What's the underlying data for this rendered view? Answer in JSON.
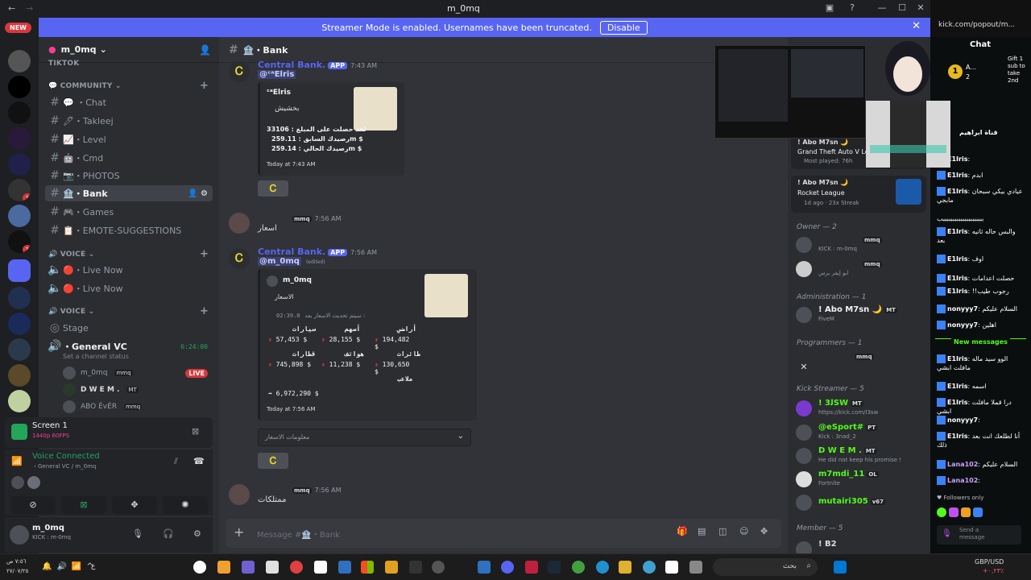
{
  "window": {
    "title": "m_0mq",
    "minimize": "—",
    "maximize": "☐",
    "close": "✕"
  },
  "banner": {
    "text": "Streamer Mode is enabled. Usernames have been truncated.",
    "disable": "Disable"
  },
  "rail": {
    "new_label": "NEW",
    "badges": [
      "1",
      "1"
    ]
  },
  "server": {
    "name": "m_0mq"
  },
  "channels": {
    "top_partial": "TIKTOK",
    "category_community": "COMMUNITY",
    "chat": "💬 ・Chat",
    "takleej": "🖊・Takleej",
    "level": "📈・Level",
    "cmd": "🤖・Cmd",
    "photos": "📷・PHOTOS",
    "bank": "🏦・Bank",
    "games": "🎮・Games",
    "emote": "📋・EMOTE-SUGGESTIONS",
    "category_voice1": "VOICE",
    "live_now_1": "🔴・Live Now",
    "live_now_2": "🔴・Live Now",
    "category_voice2": "VOICE",
    "stage": "Stage",
    "general_vc": "・General VC",
    "general_vc_time": "6:24:00",
    "status_hint": "Set a channel status",
    "voice_users": [
      {
        "name": "m_0mq",
        "tag": "mmq",
        "live": "LIVE"
      },
      {
        "name": "D W E M .",
        "tag": "MT"
      },
      {
        "name": "ABO ÉvÉR",
        "tag": "mmq"
      }
    ]
  },
  "screen_panel": {
    "title": "Screen 1",
    "sub": "1440p 60FPS"
  },
  "voice_panel": {
    "status": "Voice Connected",
    "location": "・General VC / m_0mq"
  },
  "user_panel": {
    "name": "m_0mq",
    "sub": "KICK : m-0mq"
  },
  "chat": {
    "header": "🏦・Bank",
    "messages": [
      {
        "author": "Central Bank.",
        "app": "APP",
        "time": "7:43 AM",
        "mention": "@ᶜᵃElris",
        "embed": {
          "author": "ᶜᵃElris",
          "title": "بخشيش",
          "line1": "لقد حصلت على المبلغ : 33106",
          "line2": "رصيدك السابق : 259.11m $",
          "line3": "رصيدك الحالي : 259.14m $",
          "footer": "Today at 7:43 AM"
        }
      },
      {
        "author": "mmq",
        "time": "7:56 AM",
        "text": "اسعار"
      },
      {
        "author": "Central Bank.",
        "app": "APP",
        "time": "7:56 AM",
        "mention": "@m_0mq",
        "edited": "(edited)",
        "embed": {
          "author": "m_0mq",
          "title": "الاسعار",
          "update_label": "سيتم تحديث الاسعار بعد :",
          "timer": "02:39.0",
          "items": [
            {
              "label": "سيارات",
              "value": "57,453 $"
            },
            {
              "label": "أسهم",
              "value": "28,155 $"
            },
            {
              "label": "أراضي",
              "value": "194,482 $"
            },
            {
              "label": "قطارات",
              "value": "745,898 $"
            },
            {
              "label": "هواتف",
              "value": "11,238 $"
            },
            {
              "label": "طائرات",
              "value": "130,650 $"
            },
            {
              "label": "ملاعب",
              "value": "6,972,290 $"
            }
          ],
          "footer": "Today at 7:56 AM"
        },
        "select": "معلومات الاسعار"
      },
      {
        "author": "mmq",
        "time": "7:56 AM",
        "text": "ممتلكات"
      }
    ],
    "input_placeholder": "Message #🏦・Bank"
  },
  "members": {
    "activity1": {
      "name": "! Abo M7sn 🌙",
      "game": "Grand Theft Auto V Legacy",
      "detail": "Most played: 76h"
    },
    "activity2": {
      "name": "! Abo M7sn 🌙",
      "game": "Rocket League",
      "detail": "1d ago",
      "streak": "23x Streak"
    },
    "owner_header": "Owner — 2",
    "owners": [
      {
        "name": "",
        "tag": "mmq",
        "sub": "KICK : m-0mq"
      },
      {
        "name": "",
        "tag": "mmq",
        "sub": "ابو إيفر برس"
      }
    ],
    "admin_header": "Administration — 1",
    "admins": [
      {
        "name": "! Abo M7sn 🌙",
        "tag": "MT",
        "sub": "FiveM"
      }
    ],
    "prog_header": "Programmers — 1",
    "programmers": [
      {
        "name": "",
        "tag": "mmq"
      }
    ],
    "kick_header": "Kick Streamer — 5",
    "kick_streamers": [
      {
        "name": "! ﻟ3SW",
        "tag": "MT",
        "sub": "https://kick.com/l3sw"
      },
      {
        "name": "@eSport#",
        "tag": "PT",
        "sub": "Kick : 3nad_2"
      },
      {
        "name": "D W E M .",
        "tag": "MT",
        "sub": "He did not keep his promise !"
      },
      {
        "name": "m7mdi_11",
        "tag": "OL",
        "sub": "Fortnite"
      },
      {
        "name": "mutairi305",
        "tag": "v67",
        "sub": ""
      }
    ],
    "member_header": "Member — 5",
    "member_first": "! B2"
  },
  "kick": {
    "url": "kick.com/popout/m...",
    "chat_title": "Chat",
    "gift_text": "Gift 1 sub to take 2nd",
    "pinned": "قناة ابراهيم",
    "lines": [
      {
        "user": "E1Iris",
        "text": ""
      },
      {
        "user": "E1Iris",
        "text": "ابدم"
      },
      {
        "user": "E1Iris",
        "text": "عيادي بيكي سبحان مابجي"
      },
      {
        "user": "",
        "text": "بببببببببببببببببببببب"
      },
      {
        "user": "E1Iris",
        "text": "والبس حاله ثانيه بعد"
      },
      {
        "user": "E1Iris",
        "text": "اوف"
      },
      {
        "user": "E1Iris",
        "text": "حصلت اعدامات"
      },
      {
        "user": "E1Iris",
        "text": "!!رجوب طيب"
      },
      {
        "user": "nonyyy7",
        "text": "السلام عليكم"
      },
      {
        "user": "nonyyy7",
        "text": "اهلين"
      },
      {
        "user": "E1Iris",
        "text": "الوو سيد ماله مافلت ابشي"
      },
      {
        "user": "E1Iris",
        "text": "اسمه"
      },
      {
        "user": "E1Iris",
        "text": "درا قملا مافلت ابشي"
      },
      {
        "user": "nonyyy7",
        "text": ""
      },
      {
        "user": "E1Iris",
        "text": "أنا لطلعك انت بعد ذلك"
      },
      {
        "user": "Lana102",
        "text": "السلام عليكم"
      },
      {
        "user": "Lana102",
        "text": ""
      }
    ],
    "new_messages": "New messages",
    "followers_only": "Followers only",
    "send_placeholder": "Send a message",
    "top_user": "A...",
    "top_count": "2"
  },
  "taskbar": {
    "clock_time": "٧:٥٦ ص",
    "clock_date": "٢٧/٠٧/٢٥",
    "lang": "ع",
    "search": "بحث",
    "currency": "GBP/USD",
    "currency_val": "+٠,٢٣٪"
  },
  "colors": {
    "accent": "#5865f2",
    "kick_green": "#53fc18",
    "red": "#da373c"
  }
}
